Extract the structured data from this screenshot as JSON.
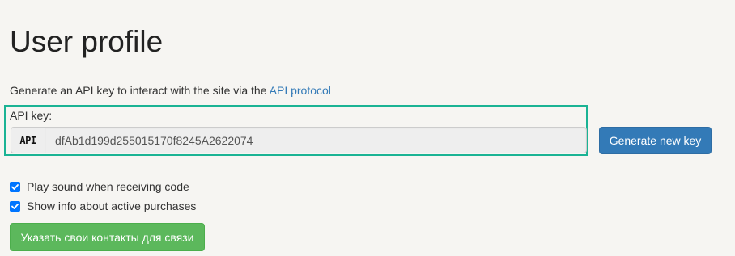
{
  "page": {
    "title": "User profile"
  },
  "description": {
    "text": "Generate an API key to interact with the site via the ",
    "link_text": "API protocol"
  },
  "api_key": {
    "label": "API key:",
    "addon_label": "API",
    "value": "dfAb1d199d255015170f8245A2622074",
    "generate_button_label": "Generate new key"
  },
  "options": [
    {
      "label": "Play sound when receiving code",
      "checked": true
    },
    {
      "label": "Show info about active purchases",
      "checked": true
    }
  ],
  "contacts_button_label": "Указать свои контакты для связи",
  "colors": {
    "highlight_border": "#1ab394",
    "primary_button": "#337ab7",
    "success_button": "#5cb85c",
    "link": "#337ab7",
    "checkbox": "#0075ff"
  }
}
